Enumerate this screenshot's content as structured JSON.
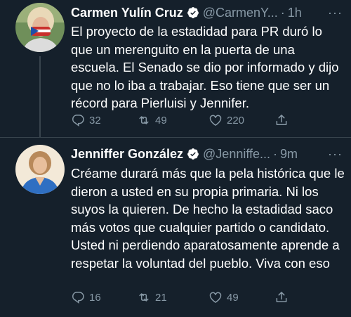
{
  "tweets": [
    {
      "author_name": "Carmen Yulín Cruz",
      "handle": "@CarmenY...",
      "separator": "·",
      "time": "1h",
      "more": "···",
      "text": "El proyecto de la estadidad para PR duró lo que un merenguito en la puerta de una escuela. El Senado se dio por informado y dijo que no lo iba a trabajar. Eso tiene que ser un récord para Pierluisi y Jennifer.",
      "replies": "32",
      "retweets": "49",
      "likes": "220"
    },
    {
      "author_name": "Jenniffer González",
      "handle": "@Jenniffe...",
      "separator": "·",
      "time": "9m",
      "more": "···",
      "text": "Créame durará más que la pela histórica que le dieron a usted en su propia primaria. Ni los suyos la quieren. De hecho la estadidad saco más votos que cualquier partido o candidato. Usted ni perdiendo aparatosamente aprende a respetar la voluntad del pueblo.  Viva con eso",
      "replies": "16",
      "retweets": "21",
      "likes": "49"
    }
  ],
  "icons": {
    "reply": "reply-icon",
    "retweet": "retweet-icon",
    "like": "heart-icon",
    "share": "share-icon",
    "verified": "verified-badge-icon"
  },
  "colors": {
    "background": "#15202b",
    "secondary_text": "#8899a6",
    "divider": "#38444d"
  }
}
